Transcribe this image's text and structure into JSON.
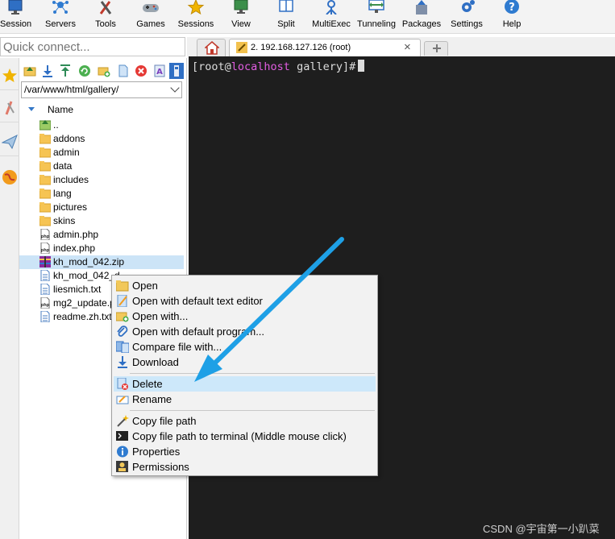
{
  "toolbar": {
    "items": [
      {
        "label": "Session"
      },
      {
        "label": "Servers"
      },
      {
        "label": "Tools"
      },
      {
        "label": "Games"
      },
      {
        "label": "Sessions"
      },
      {
        "label": "View"
      },
      {
        "label": "Split"
      },
      {
        "label": "MultiExec"
      },
      {
        "label": "Tunneling"
      },
      {
        "label": "Packages"
      },
      {
        "label": "Settings"
      },
      {
        "label": "Help"
      }
    ]
  },
  "quick_connect": {
    "placeholder": "Quick connect..."
  },
  "sftp": {
    "path": "/var/www/html/gallery/",
    "column_name": "Name",
    "files": [
      {
        "name": "..",
        "type": "parent"
      },
      {
        "name": "addons",
        "type": "folder"
      },
      {
        "name": "admin",
        "type": "folder"
      },
      {
        "name": "data",
        "type": "folder"
      },
      {
        "name": "includes",
        "type": "folder"
      },
      {
        "name": "lang",
        "type": "folder"
      },
      {
        "name": "pictures",
        "type": "folder"
      },
      {
        "name": "skins",
        "type": "folder"
      },
      {
        "name": "admin.php",
        "type": "php"
      },
      {
        "name": "index.php",
        "type": "php"
      },
      {
        "name": "kh_mod_042.zip",
        "type": "zip"
      },
      {
        "name": "kh_mod_042_d",
        "type": "text"
      },
      {
        "name": "liesmich.txt",
        "type": "text"
      },
      {
        "name": "mg2_update.pl",
        "type": "php"
      },
      {
        "name": "readme.zh.txt",
        "type": "text"
      }
    ]
  },
  "tabs": {
    "session_tab": "2. 192.168.127.126 (root)",
    "close_glyph": "×"
  },
  "terminal": {
    "prompt_open": "[root@",
    "host": "localhost",
    "prompt_rest": " gallery]#"
  },
  "context_menu": {
    "items": [
      {
        "label": "Open"
      },
      {
        "label": "Open with default text editor"
      },
      {
        "label": "Open with..."
      },
      {
        "label": "Open with default program..."
      },
      {
        "label": "Compare file with..."
      },
      {
        "label": "Download"
      },
      {
        "label": "Delete"
      },
      {
        "label": "Rename"
      },
      {
        "label": "Copy file path"
      },
      {
        "label": "Copy file path to terminal (Middle mouse click)"
      },
      {
        "label": "Properties"
      },
      {
        "label": "Permissions"
      }
    ]
  },
  "watermark": "CSDN @宇宙第一小趴菜",
  "colors": {
    "terminal_bg": "#1e1e1e",
    "hostname": "#e15de1",
    "arrow": "#1ea0e6",
    "selection": "#cce4f7"
  }
}
